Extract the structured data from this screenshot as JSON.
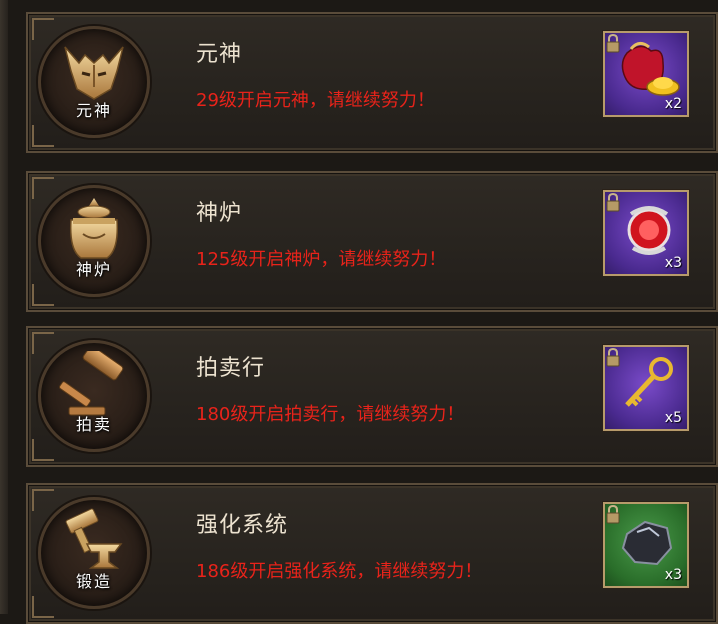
{
  "features": [
    {
      "title": "元神",
      "emblem_label": "元神",
      "message": "29级开启元神，请继续努力！",
      "emblem_icon": "demon-mask-icon",
      "reward": {
        "icon": "treasure-bag-icon",
        "qty": "x2",
        "rarity": "purple"
      }
    },
    {
      "title": "神炉",
      "emblem_label": "神炉",
      "message": "125级开启神炉，请继续努力！",
      "emblem_icon": "furnace-icon",
      "reward": {
        "icon": "red-orb-icon",
        "qty": "x3",
        "rarity": "purple"
      }
    },
    {
      "title": "拍卖行",
      "emblem_label": "拍卖",
      "message": "180级开启拍卖行，请继续努力！",
      "emblem_icon": "gavel-icon",
      "reward": {
        "icon": "golden-key-icon",
        "qty": "x5",
        "rarity": "purple"
      }
    },
    {
      "title": "强化系统",
      "emblem_label": "锻造",
      "message": "186级开启强化系统，请继续努力！",
      "emblem_icon": "anvil-icon",
      "reward": {
        "icon": "ore-stone-icon",
        "qty": "x3",
        "rarity": "green"
      }
    }
  ],
  "colors": {
    "message_red": "#e8231a",
    "title_cream": "#ece2cf",
    "purple_slot": "#4a2a8f",
    "green_slot": "#2a6e2a"
  }
}
